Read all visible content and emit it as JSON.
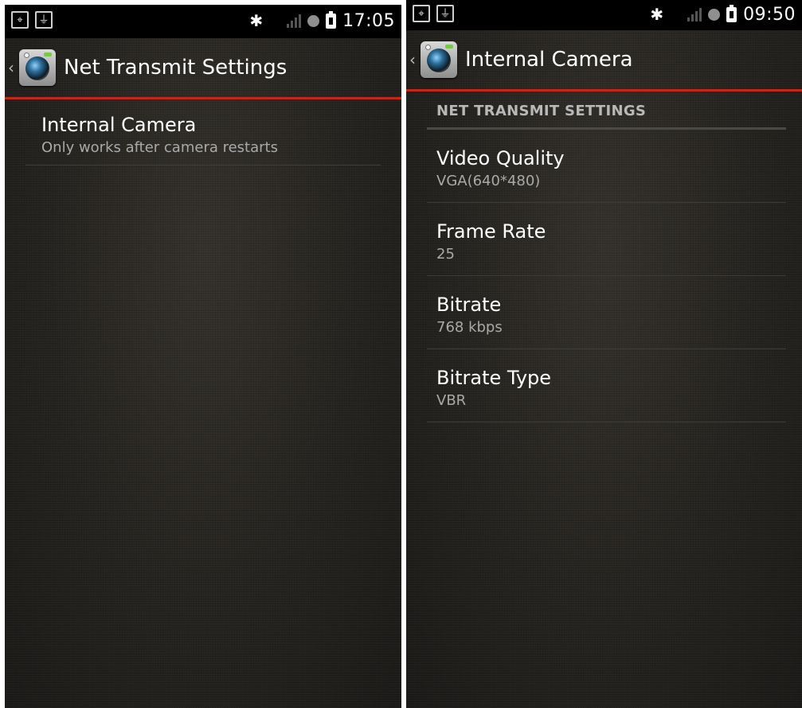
{
  "screens": [
    {
      "status": {
        "time": "17:05",
        "left_icons": [
          "gps-icon",
          "usb-plug-icon"
        ],
        "right_icons": [
          "bluetooth-icon",
          "signal-icon",
          "sync-icon",
          "battery-icon"
        ]
      },
      "action_bar": {
        "title": "Net Transmit Settings",
        "app_icon": "camera-app-icon"
      },
      "items": [
        {
          "title": "Internal Camera",
          "summary": "Only works after camera restarts"
        }
      ]
    },
    {
      "status": {
        "time": "09:50",
        "left_icons": [
          "gps-icon",
          "usb-plug-icon"
        ],
        "right_icons": [
          "bluetooth-icon",
          "signal-icon",
          "sync-icon",
          "battery-icon"
        ]
      },
      "action_bar": {
        "title": "Internal Camera",
        "app_icon": "camera-app-icon"
      },
      "category": "NET TRANSMIT SETTINGS",
      "items": [
        {
          "title": "Video Quality",
          "summary": "VGA(640*480)"
        },
        {
          "title": "Frame Rate",
          "summary": "25"
        },
        {
          "title": "Bitrate",
          "summary": "768 kbps"
        },
        {
          "title": "Bitrate Type",
          "summary": "VBR"
        }
      ]
    }
  ],
  "colors": {
    "accent": "#c2271a",
    "background": "#1e1d1b",
    "text_primary": "#ffffff",
    "text_secondary": "#a9a9a9"
  }
}
